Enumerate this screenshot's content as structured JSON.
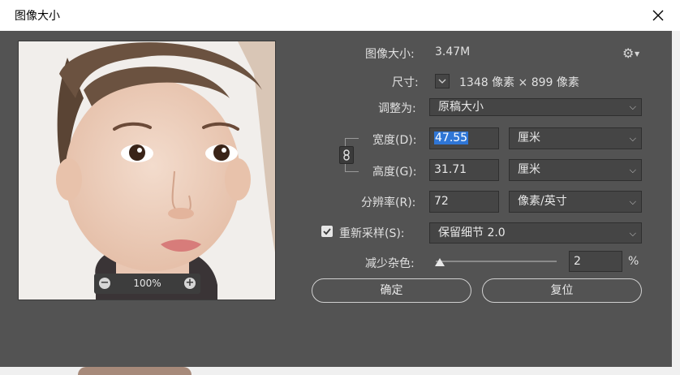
{
  "window": {
    "title": "图像大小"
  },
  "preview": {
    "zoom_label": "100%"
  },
  "info": {
    "image_size_label": "图像大小:",
    "image_size_value": "3.47M",
    "dimensions_label": "尺寸:",
    "dimensions_value": "1348 像素  ×  899 像素"
  },
  "fit_to": {
    "label": "调整为:",
    "value": "原稿大小"
  },
  "width": {
    "label": "宽度(D):",
    "value": "47.55",
    "unit": "厘米"
  },
  "height": {
    "label": "高度(G):",
    "value": "31.71",
    "unit": "厘米"
  },
  "resolution": {
    "label": "分辨率(R):",
    "value": "72",
    "unit": "像素/英寸"
  },
  "resample": {
    "label": "重新采样(S):",
    "checked": true,
    "method": "保留细节 2.0"
  },
  "reduce_noise": {
    "label": "减少杂色:",
    "value": "2",
    "unit": "%",
    "level": 0
  },
  "buttons": {
    "ok": "确定",
    "reset": "复位"
  },
  "colors": {
    "panel_bg": "#535353",
    "selection": "#2f76d6"
  }
}
